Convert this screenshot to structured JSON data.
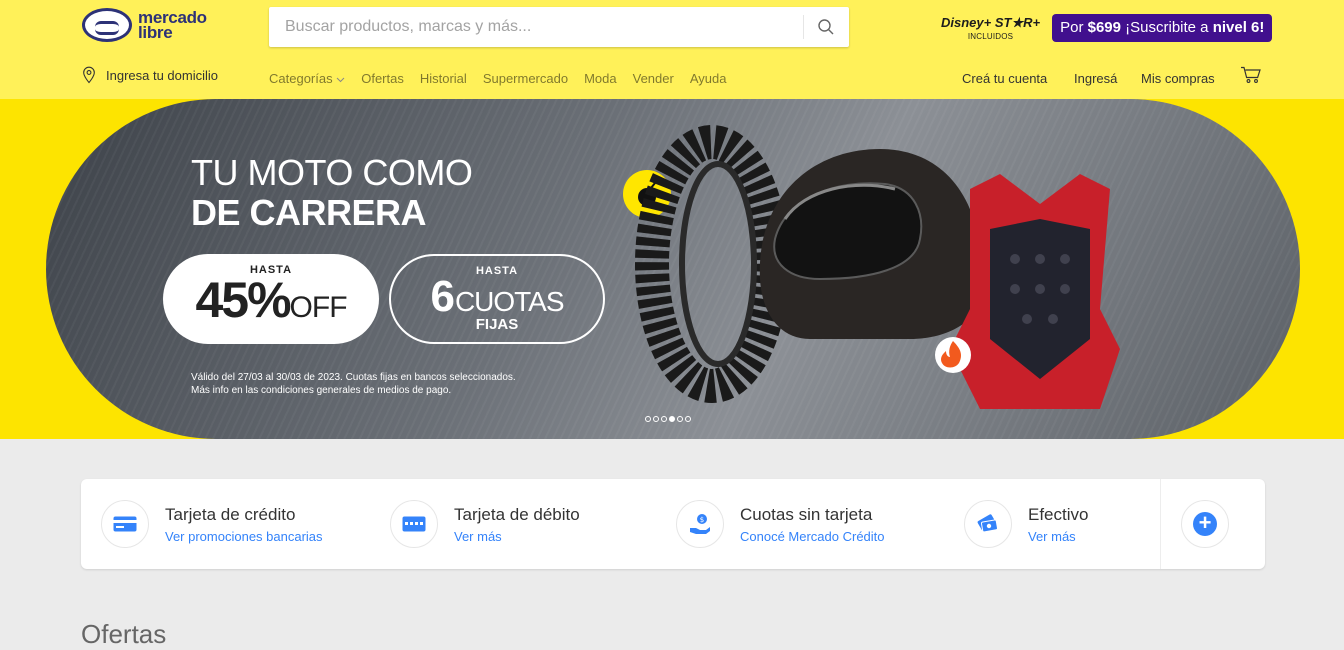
{
  "header": {
    "logo_text_line1": "mercado",
    "logo_text_line2": "libre",
    "search_placeholder": "Buscar productos, marcas y más...",
    "promo_brand_text": "Disney+ ST★R+",
    "promo_included": "INCLUIDOS",
    "promo_btn_prefix": "Por ",
    "promo_btn_price": "$699",
    "promo_btn_text": " ¡Suscribite a ",
    "promo_btn_level": "nivel 6",
    "promo_btn_suffix": "!",
    "promo_color": "#41108e",
    "brand_yellow": "#fff159",
    "location_label": "Ingresa tu domicilio",
    "nav": [
      "Categorías",
      "Ofertas",
      "Historial",
      "Supermercado",
      "Moda",
      "Vender",
      "Ayuda"
    ],
    "account": {
      "create": "Creá tu cuenta",
      "login": "Ingresá",
      "purchases": "Mis compras"
    }
  },
  "hero": {
    "title_line1": "TU MOTO COMO",
    "title_line2": "DE CARRERA",
    "off_pre": "HASTA",
    "off_value": "45%",
    "off_suffix": "OFF",
    "cuotas_pre": "HASTA",
    "cuotas_value": "6",
    "cuotas_suffix": "CUOTAS",
    "cuotas_post": "FIJAS",
    "legal_line1": "Válido del 27/03 al 30/03 de 2023. Cuotas fijas en bancos seleccionados.",
    "legal_line2": "Más info en las condiciones generales de medios de pago.",
    "slides_total": 6,
    "slide_active": 4
  },
  "payments": [
    {
      "title": "Tarjeta de crédito",
      "link": "Ver promociones bancarias",
      "icon": "credit-card-icon"
    },
    {
      "title": "Tarjeta de débito",
      "link": "Ver más",
      "icon": "debit-card-icon"
    },
    {
      "title": "Cuotas sin tarjeta",
      "link": "Conocé Mercado Crédito",
      "icon": "mercado-credito-icon"
    },
    {
      "title": "Efectivo",
      "link": "Ver más",
      "icon": "cash-icon"
    }
  ],
  "section_title": "Ofertas"
}
